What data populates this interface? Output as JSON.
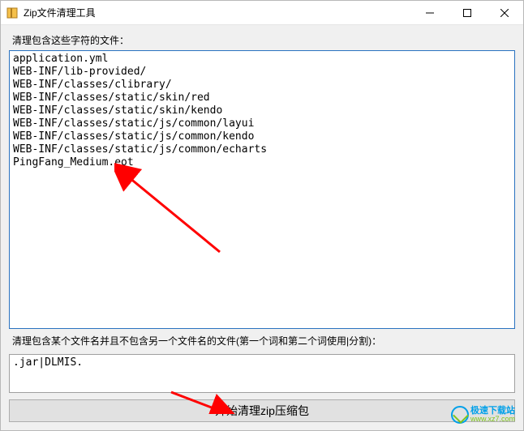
{
  "window": {
    "title": "Zip文件清理工具"
  },
  "labels": {
    "section1": "清理包含这些字符的文件：",
    "section2": "清理包含某个文件名并且不包含另一个文件名的文件(第一个词和第二个词使用|分割)：",
    "main_button": "开始清理zip压缩包"
  },
  "textbox1_content": "application.yml\nWEB-INF/lib-provided/\nWEB-INF/classes/clibrary/\nWEB-INF/classes/static/skin/red\nWEB-INF/classes/static/skin/kendo\nWEB-INF/classes/static/js/common/layui\nWEB-INF/classes/static/js/common/kendo\nWEB-INF/classes/static/js/common/echarts\nPingFang_Medium.eot",
  "textbox2_content": ".jar|DLMIS.",
  "watermark": {
    "cn": "极速下载站",
    "url": "www.xz7.com"
  }
}
